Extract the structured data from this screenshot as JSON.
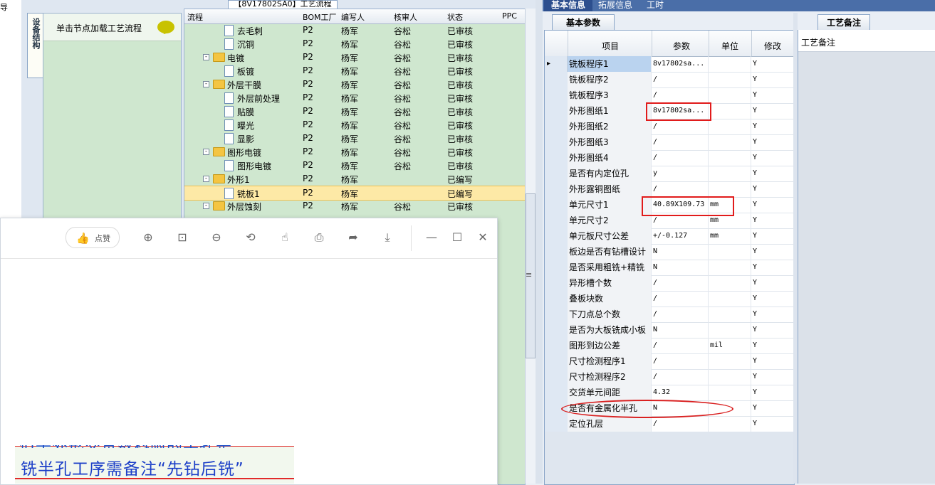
{
  "left_strip": {
    "glyph": "导"
  },
  "tree_title": "【8V17802SA0】工艺流程",
  "vertical_tab": "设备结构",
  "node_panel": {
    "hint": "单击节点加载工艺流程",
    "hint_icon": "speech-bubble-icon"
  },
  "tree_grid": {
    "columns": [
      "流程",
      "BOM工厂",
      "编写人",
      "核审人",
      "状态",
      "PPC"
    ],
    "rows": [
      {
        "name": "去毛刺",
        "level": 2,
        "type": "doc",
        "bom": "P2",
        "writer": "杨军",
        "reviewer": "谷松",
        "status": "已审核"
      },
      {
        "name": "沉铜",
        "level": 2,
        "type": "doc",
        "bom": "P2",
        "writer": "杨军",
        "reviewer": "谷松",
        "status": "已审核"
      },
      {
        "name": "电镀",
        "level": 1,
        "type": "folder",
        "bom": "P2",
        "writer": "杨军",
        "reviewer": "谷松",
        "status": "已审核"
      },
      {
        "name": "板镀",
        "level": 2,
        "type": "doc",
        "bom": "P2",
        "writer": "杨军",
        "reviewer": "谷松",
        "status": "已审核"
      },
      {
        "name": "外层干膜",
        "level": 1,
        "type": "folder",
        "bom": "P2",
        "writer": "杨军",
        "reviewer": "谷松",
        "status": "已审核"
      },
      {
        "name": "外层前处理",
        "level": 2,
        "type": "doc",
        "bom": "P2",
        "writer": "杨军",
        "reviewer": "谷松",
        "status": "已审核"
      },
      {
        "name": "贴膜",
        "level": 2,
        "type": "doc",
        "bom": "P2",
        "writer": "杨军",
        "reviewer": "谷松",
        "status": "已审核"
      },
      {
        "name": "曝光",
        "level": 2,
        "type": "doc",
        "bom": "P2",
        "writer": "杨军",
        "reviewer": "谷松",
        "status": "已审核"
      },
      {
        "name": "显影",
        "level": 2,
        "type": "doc",
        "bom": "P2",
        "writer": "杨军",
        "reviewer": "谷松",
        "status": "已审核"
      },
      {
        "name": "图形电镀",
        "level": 1,
        "type": "folder",
        "bom": "P2",
        "writer": "杨军",
        "reviewer": "谷松",
        "status": "已审核"
      },
      {
        "name": "图形电镀",
        "level": 2,
        "type": "doc",
        "bom": "P2",
        "writer": "杨军",
        "reviewer": "谷松",
        "status": "已审核"
      },
      {
        "name": "外形1",
        "level": 1,
        "type": "folder",
        "bom": "P2",
        "writer": "杨军",
        "reviewer": "",
        "status": "已编写"
      },
      {
        "name": "铣板1",
        "level": 2,
        "type": "doc",
        "bom": "P2",
        "writer": "杨军",
        "reviewer": "",
        "status": "已编写",
        "selected": true
      },
      {
        "name": "外层蚀刻",
        "level": 1,
        "type": "folder",
        "bom": "P2",
        "writer": "杨军",
        "reviewer": "谷松",
        "status": "已审核"
      }
    ]
  },
  "viewer": {
    "like_label": "点赞",
    "tools": [
      "zoom-in-icon",
      "fit-icon",
      "zoom-out-icon",
      "rotate-icon",
      "hand-icon",
      "print-icon",
      "share-icon",
      "download-icon"
    ],
    "window_buttons": [
      "minimize-icon",
      "maximize-icon",
      "close-icon"
    ],
    "image_text_partial": "但子外形交贷数科附的半孔是",
    "image_text": "铣半孔工序需备注“先钻后铣”"
  },
  "right_tabs": [
    "基本信息",
    "拓展信息",
    "工时"
  ],
  "sub_tab": "基本参数",
  "memo_tab": "工艺备注",
  "memo_header": "工艺备注",
  "param_grid": {
    "columns": [
      "项目",
      "参数",
      "单位",
      "修改"
    ],
    "rows": [
      {
        "item": "铣板程序1",
        "value": "8v17802sa...",
        "unit": "",
        "mod": "Y",
        "current": true
      },
      {
        "item": "铣板程序2",
        "value": "/",
        "unit": "",
        "mod": "Y"
      },
      {
        "item": "铣板程序3",
        "value": "/",
        "unit": "",
        "mod": "Y"
      },
      {
        "item": "外形图纸1",
        "value": "8v17802sa...",
        "unit": "",
        "mod": "Y"
      },
      {
        "item": "外形图纸2",
        "value": "/",
        "unit": "",
        "mod": "Y"
      },
      {
        "item": "外形图纸3",
        "value": "/",
        "unit": "",
        "mod": "Y"
      },
      {
        "item": "外形图纸4",
        "value": "/",
        "unit": "",
        "mod": "Y"
      },
      {
        "item": "是否有内定位孔",
        "value": "y",
        "unit": "",
        "mod": "Y"
      },
      {
        "item": "外形露铜图纸",
        "value": "/",
        "unit": "",
        "mod": "Y"
      },
      {
        "item": "单元尺寸1",
        "value": "40.89X109.73",
        "unit": "mm",
        "mod": "Y"
      },
      {
        "item": "单元尺寸2",
        "value": "/",
        "unit": "mm",
        "mod": "Y"
      },
      {
        "item": "单元板尺寸公差",
        "value": "+/-0.127",
        "unit": "mm",
        "mod": "Y"
      },
      {
        "item": "板边是否有钻槽设计",
        "value": "N",
        "unit": "",
        "mod": "Y"
      },
      {
        "item": "是否采用粗铣+精铣",
        "value": "N",
        "unit": "",
        "mod": "Y"
      },
      {
        "item": "异形槽个数",
        "value": "/",
        "unit": "",
        "mod": "Y"
      },
      {
        "item": "叠板块数",
        "value": "/",
        "unit": "",
        "mod": "Y"
      },
      {
        "item": "下刀点总个数",
        "value": "/",
        "unit": "",
        "mod": "Y"
      },
      {
        "item": "是否为大板铣成小板",
        "value": "N",
        "unit": "",
        "mod": "Y"
      },
      {
        "item": "图形到边公差",
        "value": "/",
        "unit": "mil",
        "mod": "Y"
      },
      {
        "item": "尺寸检测程序1",
        "value": "/",
        "unit": "",
        "mod": "Y"
      },
      {
        "item": "尺寸检测程序2",
        "value": "/",
        "unit": "",
        "mod": "Y"
      },
      {
        "item": "交货单元间距",
        "value": "4.32",
        "unit": "",
        "mod": "Y"
      },
      {
        "item": "是否有金属化半孔",
        "value": "N",
        "unit": "",
        "mod": "Y"
      },
      {
        "item": "定位孔层",
        "value": "/",
        "unit": "",
        "mod": "Y"
      }
    ]
  }
}
